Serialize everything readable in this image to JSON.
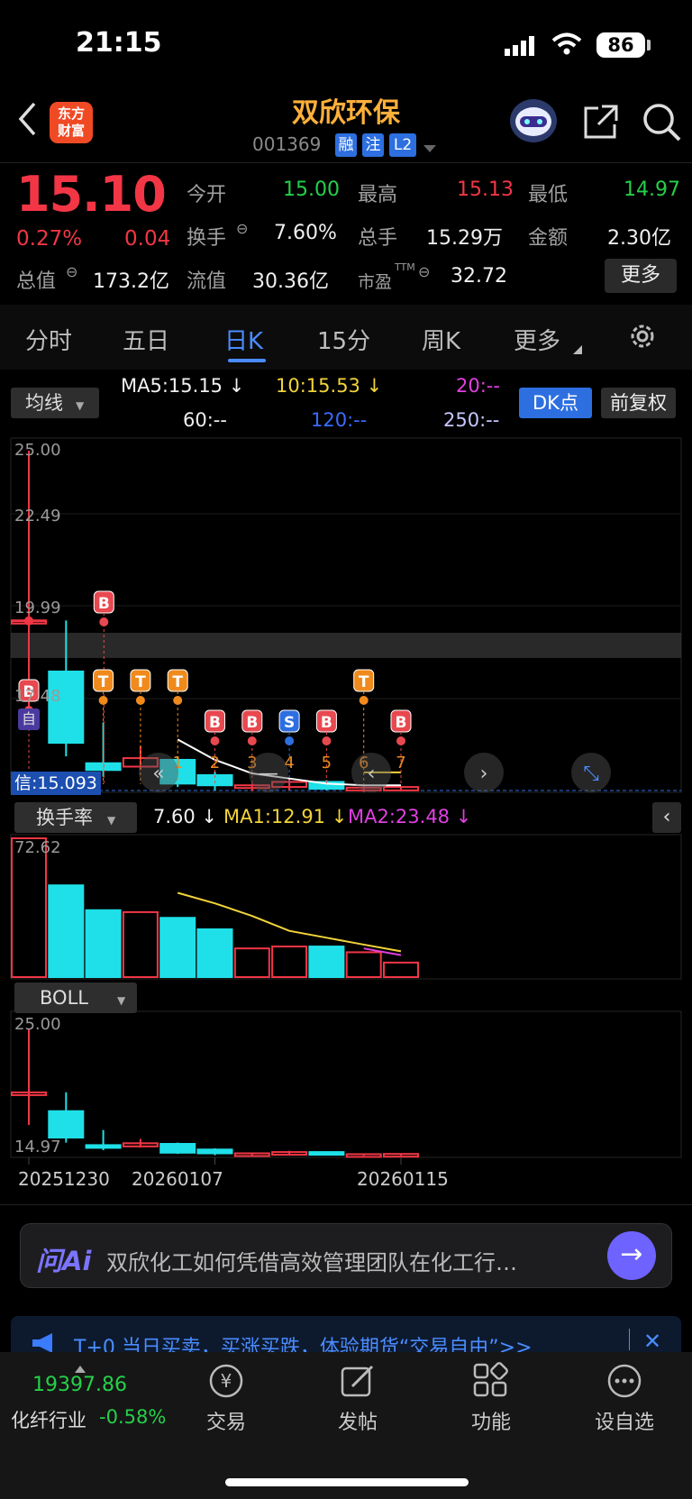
{
  "status_bar": {
    "time": "21:15",
    "battery": "86"
  },
  "header": {
    "title": "双欣环保",
    "code": "001369",
    "tags": [
      "融",
      "注",
      "L2"
    ],
    "logo_text": [
      "东方",
      "财富"
    ]
  },
  "quote": {
    "price": "15.10",
    "change_pct": "0.27%",
    "change": "0.04",
    "rows": [
      {
        "label": "今开",
        "value": "15.00",
        "label2": "最高",
        "value2": "15.13",
        "label3": "最低",
        "value3": "14.97"
      },
      {
        "label": "换手",
        "value": "7.60%",
        "label2": "总手",
        "value2": "15.29万",
        "label3": "金额",
        "value3": "2.30亿"
      },
      {
        "label": "总值",
        "value": "173.2亿",
        "label2": "流值",
        "value2": "30.36亿",
        "label3": "市盈",
        "label3_sup": "TTM",
        "value3": "32.72"
      }
    ],
    "more_label": "更多"
  },
  "tabs": [
    {
      "label": "分时"
    },
    {
      "label": "五日"
    },
    {
      "label": "日K"
    },
    {
      "label": "15分"
    },
    {
      "label": "周K"
    },
    {
      "label": "更多"
    }
  ],
  "ma_bar": {
    "select_label": "均线",
    "ma5": "MA5:15.15 ↓",
    "ma10": "10:15.53 ↓",
    "ma20": "20:--",
    "ma60": "60:--",
    "ma120": "120:--",
    "ma250": "250:--",
    "dk_label": "DK点",
    "fq_label": "前复权"
  },
  "kline": {
    "y_labels": [
      "25.00",
      "22.49",
      "19.99",
      "17.48"
    ],
    "signal_label": "信:15.093",
    "self_label": "自",
    "marks": [
      "B",
      "B",
      "T",
      "T",
      "T",
      "B",
      "B",
      "S",
      "B",
      "T",
      "B"
    ],
    "numbers": [
      "1",
      "2",
      "3",
      "4",
      "5",
      "6",
      "7"
    ]
  },
  "turnover": {
    "select_label": "换手率",
    "value": "7.60 ↓",
    "ma1": "MA1:12.91 ↓",
    "ma2": "MA2:23.48 ↓",
    "top_label": "72.62"
  },
  "boll": {
    "select_label": "BOLL",
    "top_label": "25.00",
    "bottom_label": "14.97",
    "dates": [
      "20251230",
      "20260107",
      "20260115"
    ]
  },
  "chart_data": {
    "type": "candlestick",
    "dates": [
      "20251230",
      "",
      "",
      "",
      "",
      "20260107",
      "",
      "",
      "",
      "",
      "20260115"
    ],
    "candles": [
      {
        "open": 19.99,
        "close": 19.99,
        "high": 25.0,
        "low": 17.4
      },
      {
        "open": 18.5,
        "close": 16.4,
        "high": 20.0,
        "low": 16.0
      },
      {
        "open": 15.8,
        "close": 15.6,
        "high": 17.0,
        "low": 15.4
      },
      {
        "open": 15.7,
        "close": 15.95,
        "high": 16.3,
        "low": 15.6
      },
      {
        "open": 15.9,
        "close": 15.2,
        "high": 16.0,
        "low": 15.1
      },
      {
        "open": 15.45,
        "close": 15.15,
        "high": 15.55,
        "low": 15.0
      },
      {
        "open": 15.1,
        "close": 15.15,
        "high": 15.2,
        "low": 14.98
      },
      {
        "open": 15.1,
        "close": 15.25,
        "high": 15.35,
        "low": 15.0
      },
      {
        "open": 15.25,
        "close": 15.05,
        "high": 15.3,
        "low": 15.0
      },
      {
        "open": 15.0,
        "close": 15.08,
        "high": 15.12,
        "low": 14.95
      },
      {
        "open": 15.0,
        "close": 15.1,
        "high": 15.13,
        "low": 14.97
      }
    ],
    "ma5": [
      null,
      null,
      null,
      null,
      16.5,
      15.9,
      15.5,
      15.35,
      15.2,
      15.15,
      15.15
    ],
    "ma10": [
      null,
      null,
      null,
      null,
      null,
      null,
      null,
      null,
      null,
      15.53,
      15.53
    ],
    "turnover": [
      72.62,
      48.0,
      35.0,
      34.0,
      31.0,
      25.0,
      15.0,
      16.0,
      16.0,
      13.0,
      7.6
    ],
    "turnover_up": [
      true,
      false,
      false,
      true,
      false,
      false,
      true,
      true,
      false,
      true,
      true
    ],
    "turnover_ma1": [
      null,
      null,
      null,
      null,
      44.1,
      38.6,
      32.0,
      24.2,
      20.6,
      17.0,
      13.5
    ],
    "turnover_ma2": [
      null,
      null,
      null,
      null,
      null,
      null,
      null,
      null,
      null,
      27.0,
      23.48
    ],
    "ylim": [
      14.97,
      25.0
    ]
  },
  "ai_bar": {
    "logo": "问Ai",
    "text": "双欣化工如何凭借高效管理团队在化工行…"
  },
  "promo": {
    "text": "T+0 当日买卖，买涨买跌，体验期货“交易自由”>>"
  },
  "bottom_nav": {
    "index_value": "19397.86",
    "index_label": "化纤行业",
    "index_change": "-0.58%",
    "items": [
      {
        "label": "交易"
      },
      {
        "label": "发帖"
      },
      {
        "label": "功能"
      },
      {
        "label": "设自选"
      }
    ]
  }
}
